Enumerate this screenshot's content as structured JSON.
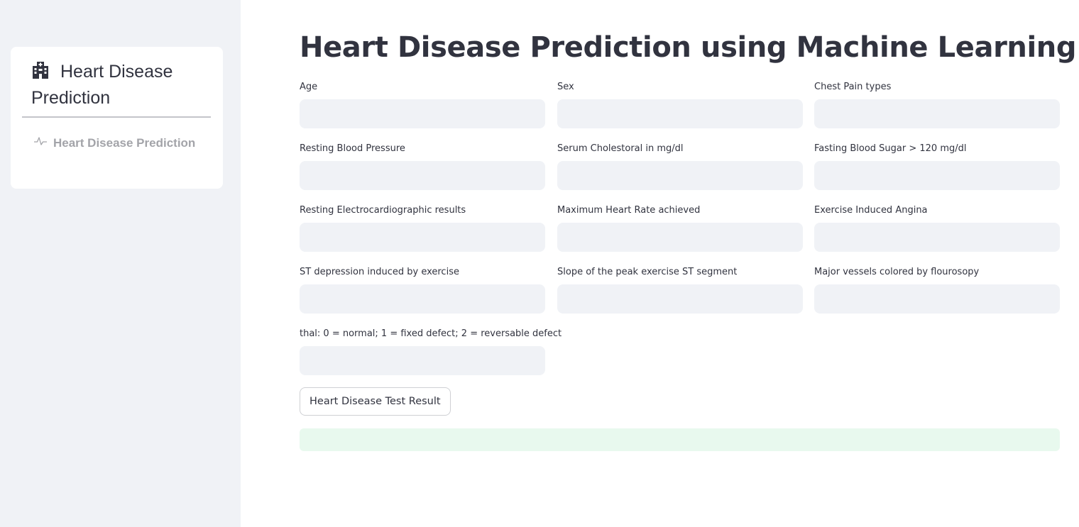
{
  "sidebar": {
    "title": "Heart Disease Prediction",
    "title_icon": "hospital-icon",
    "menu_items": [
      {
        "label": "Heart Disease Prediction",
        "icon": "pulse-icon"
      }
    ]
  },
  "main": {
    "title": "Heart Disease Prediction using Machine Learning",
    "fields": [
      {
        "label": "Age",
        "value": ""
      },
      {
        "label": "Sex",
        "value": ""
      },
      {
        "label": "Chest Pain types",
        "value": ""
      },
      {
        "label": "Resting Blood Pressure",
        "value": ""
      },
      {
        "label": "Serum Cholestoral in mg/dl",
        "value": ""
      },
      {
        "label": "Fasting Blood Sugar > 120 mg/dl",
        "value": ""
      },
      {
        "label": "Resting Electrocardiographic results",
        "value": ""
      },
      {
        "label": "Maximum Heart Rate achieved",
        "value": ""
      },
      {
        "label": "Exercise Induced Angina",
        "value": ""
      },
      {
        "label": "ST depression induced by exercise",
        "value": ""
      },
      {
        "label": "Slope of the peak exercise ST segment",
        "value": ""
      },
      {
        "label": "Major vessels colored by flourosopy",
        "value": ""
      },
      {
        "label": "thal: 0 = normal; 1 = fixed defect; 2 = reversable defect",
        "value": ""
      }
    ],
    "submit_label": "Heart Disease Test Result",
    "result_text": ""
  },
  "colors": {
    "sidebar_bg": "#f0f2f6",
    "text": "#31333f",
    "input_bg": "#f0f2f6",
    "success_bg": "#e8f9ee",
    "muted_text": "#a3a4a9"
  }
}
